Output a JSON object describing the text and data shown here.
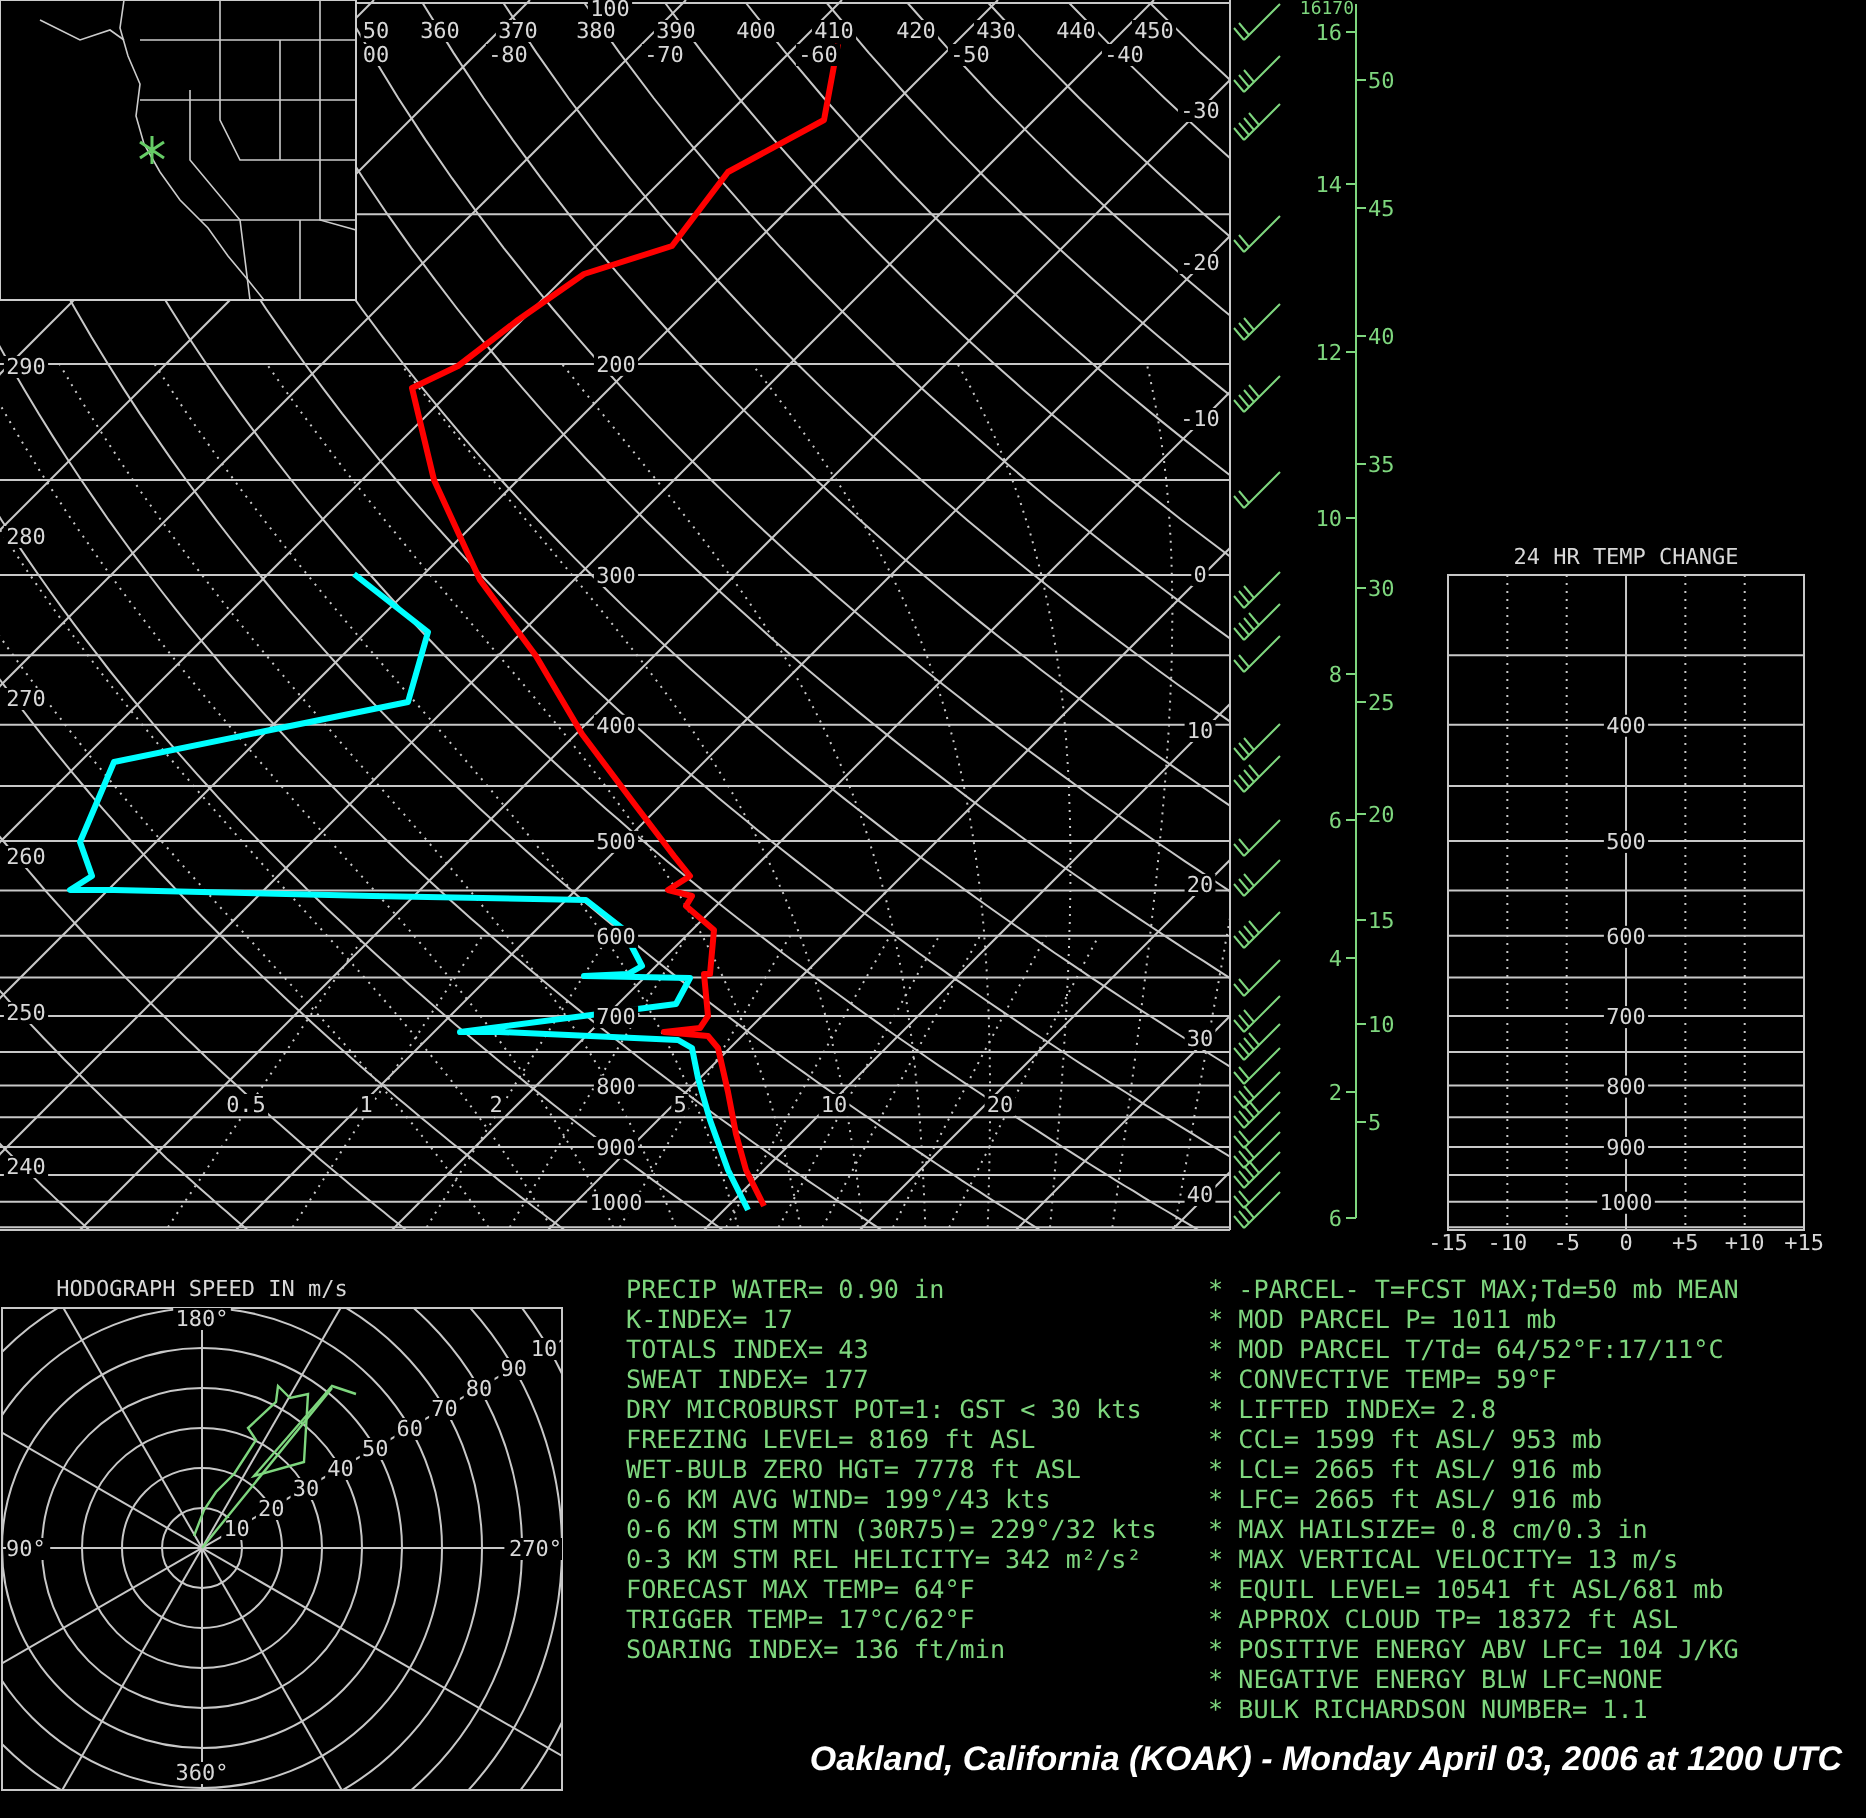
{
  "skew_t": {
    "top_theta_labels": [
      "50",
      "360",
      "370",
      "380",
      "390",
      "400",
      "410",
      "420",
      "430",
      "440",
      "450"
    ],
    "top_temperature_labels": [
      "00",
      "-80",
      "-70",
      "-60",
      "-50",
      "-40"
    ],
    "isobar_labels": [
      "100",
      "200",
      "300",
      "400",
      "500",
      "600",
      "700",
      "800",
      "900",
      "1000"
    ],
    "theta_labels": [
      "290",
      "280",
      "270",
      "260",
      "250",
      "240"
    ],
    "isotherm_labels": [
      "-30",
      "-20",
      "-10",
      "0",
      "10",
      "20",
      "30",
      "40"
    ],
    "mixing_ratio_labels": [
      "0.5",
      "1",
      "2",
      "5",
      "10",
      "20"
    ]
  },
  "height_axis": {
    "top_label": "16170",
    "km_labels": [
      "16",
      "14",
      "12",
      "10",
      "8",
      "6",
      "4",
      "2",
      "6"
    ],
    "kft_labels": [
      "50",
      "45",
      "40",
      "35",
      "30",
      "25",
      "20",
      "15",
      "10",
      "5"
    ]
  },
  "temp_change_panel": {
    "title": "24 HR TEMP CHANGE",
    "pressure_labels": [
      "400",
      "500",
      "600",
      "700",
      "800",
      "900",
      "1000"
    ],
    "x_labels": [
      "-15",
      "-10",
      "-5",
      "0",
      "+5",
      "+10",
      "+15"
    ]
  },
  "hodograph": {
    "title": "HODOGRAPH SPEED IN m/s",
    "speed_labels": [
      "10",
      "20",
      "30",
      "40",
      "50",
      "60",
      "70",
      "80",
      "90",
      "10"
    ],
    "direction_labels": [
      "180°",
      "90°",
      "270°",
      "360°"
    ]
  },
  "indices": [
    "PRECIP WATER= 0.90 in",
    "K-INDEX= 17",
    "TOTALS INDEX= 43",
    "SWEAT INDEX= 177",
    "DRY MICROBURST POT=1: GST < 30 kts",
    "FREEZING LEVEL= 8169 ft ASL",
    "WET-BULB ZERO HGT= 7778 ft ASL",
    "0-6 KM AVG WIND= 199°/43 kts",
    "0-6 KM STM MTN (30R75)= 229°/32 kts",
    "0-3 KM STM REL HELICITY= 342 m²/s²",
    "FORECAST MAX TEMP= 64°F",
    "TRIGGER TEMP= 17°C/62°F",
    "SOARING INDEX= 136 ft/min"
  ],
  "parcel_indices": [
    "* -PARCEL- T=FCST MAX;Td=50 mb MEAN",
    "* MOD PARCEL P= 1011 mb",
    "* MOD PARCEL T/Td= 64/52°F:17/11°C",
    "* CONVECTIVE TEMP= 59°F",
    "* LIFTED INDEX= 2.8",
    "* CCL= 1599 ft ASL/ 953 mb",
    "* LCL= 2665 ft ASL/ 916 mb",
    "* LFC= 2665 ft ASL/ 916 mb",
    "* MAX HAILSIZE= 0.8 cm/0.3 in",
    "* MAX VERTICAL VELOCITY= 13 m/s",
    "* EQUIL LEVEL= 10541 ft ASL/681 mb",
    "* APPROX CLOUD TP= 18372 ft ASL",
    "* POSITIVE ENERGY ABV LFC= 104 J/KG",
    "* NEGATIVE ENERGY BLW LFC=NONE",
    "* BULK RICHARDSON NUMBER= 1.1"
  ],
  "caption": "Oakland, California (KOAK) - Monday April 03, 2006 at 1200 UTC"
}
